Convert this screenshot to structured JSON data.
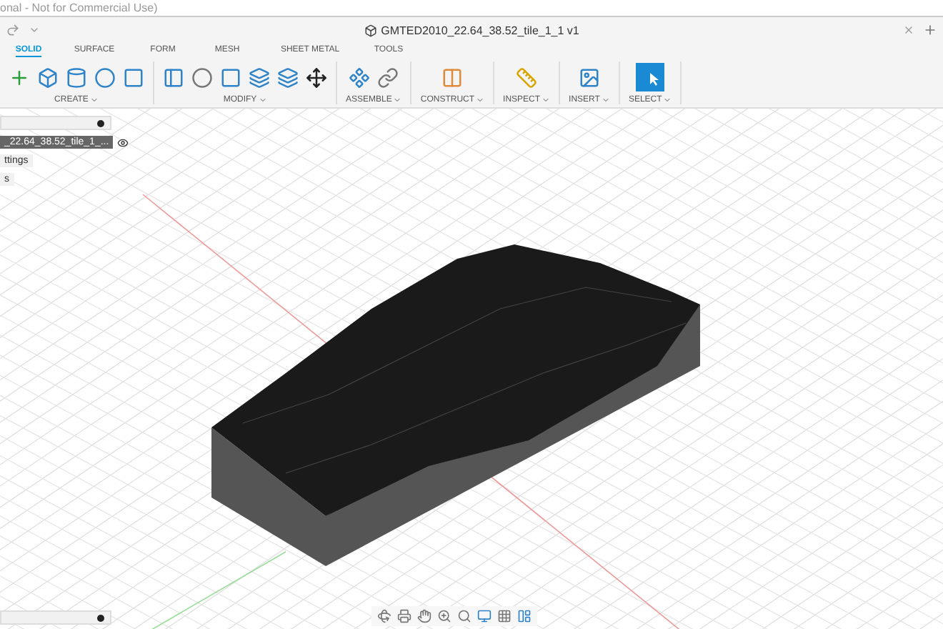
{
  "app_title": "onal - Not for Commercial Use)",
  "document_tab": {
    "title": "GMTED2010_22.64_38.52_tile_1_1 v1"
  },
  "ribbon_tabs": [
    {
      "label": "SOLID",
      "selected": true
    },
    {
      "label": "SURFACE",
      "selected": false
    },
    {
      "label": "FORM",
      "selected": false
    },
    {
      "label": "MESH",
      "selected": false
    },
    {
      "label": "SHEET METAL",
      "selected": false
    },
    {
      "label": "TOOLS",
      "selected": false
    }
  ],
  "ribbon_groups": [
    {
      "label": "CREATE"
    },
    {
      "label": "MODIFY"
    },
    {
      "label": "ASSEMBLE"
    },
    {
      "label": "CONSTRUCT"
    },
    {
      "label": "INSPECT"
    },
    {
      "label": "INSERT"
    },
    {
      "label": "SELECT"
    }
  ],
  "browser": {
    "rows": [
      {
        "label": "_22.64_38.52_tile_1_...",
        "kind": "document"
      },
      {
        "label": "ttings",
        "kind": "node"
      },
      {
        "label": "s",
        "kind": "node"
      }
    ]
  }
}
